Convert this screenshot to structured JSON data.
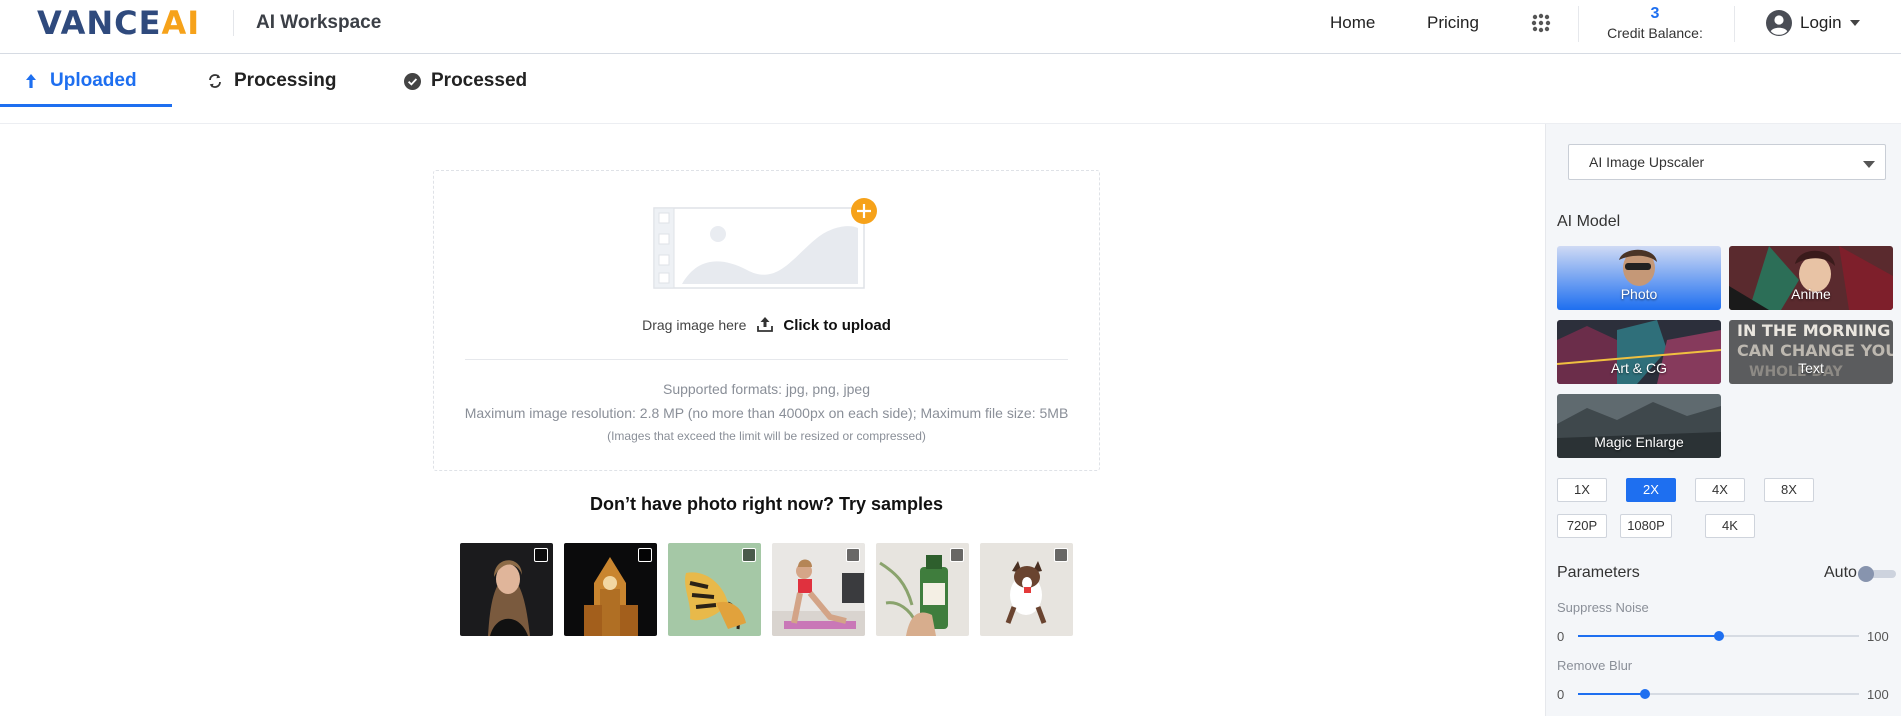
{
  "header": {
    "logo_main": "VANCE",
    "logo_accent": "AI",
    "workspace_title": "AI Workspace",
    "nav": {
      "home": "Home",
      "pricing": "Pricing"
    },
    "apps_icon": "apps-grid-icon",
    "credit": {
      "value": "3",
      "label": "Credit Balance:"
    },
    "login_label": "Login"
  },
  "tabs": [
    {
      "label": "Uploaded",
      "icon": "upload-arrow-icon",
      "active": true
    },
    {
      "label": "Processing",
      "icon": "refresh-icon",
      "active": false
    },
    {
      "label": "Processed",
      "icon": "check-circle-icon",
      "active": false
    }
  ],
  "upload": {
    "drag_text": "Drag image here",
    "click_text": "Click to upload",
    "formats": "Supported formats: jpg, png, jpeg",
    "max_resolution": "Maximum image resolution: 2.8 MP (no more than 4000px on each side); Maximum file size: 5MB",
    "exceed_note": "(Images that exceed the limit will be resized or compressed)"
  },
  "samples": {
    "title": "Don’t have photo right now? Try samples",
    "items": [
      "woman-portrait",
      "clock-tower",
      "butterfly",
      "yoga-woman",
      "green-bottle",
      "running-dog"
    ]
  },
  "panel": {
    "tool_select": "AI Image Upscaler",
    "ai_model_label": "AI Model",
    "models": [
      "Photo",
      "Anime",
      "Art & CG",
      "Text",
      "Magic Enlarge"
    ],
    "selected_model": "Photo",
    "scales_row1": [
      "1X",
      "2X",
      "4X",
      "8X"
    ],
    "scales_row2": [
      "720P",
      "1080P",
      "4K"
    ],
    "selected_scale": "2X",
    "params_label": "Parameters",
    "auto_label": "Auto",
    "auto_on": false,
    "sliders": [
      {
        "label": "Suppress Noise",
        "min": "0",
        "max": "100",
        "value": 50
      },
      {
        "label": "Remove Blur",
        "min": "0",
        "max": "100",
        "value": 24
      }
    ]
  },
  "colors": {
    "brand_blue": "#1e6ff0",
    "logo_navy": "#2f4a7d",
    "logo_orange": "#f6a21a"
  }
}
